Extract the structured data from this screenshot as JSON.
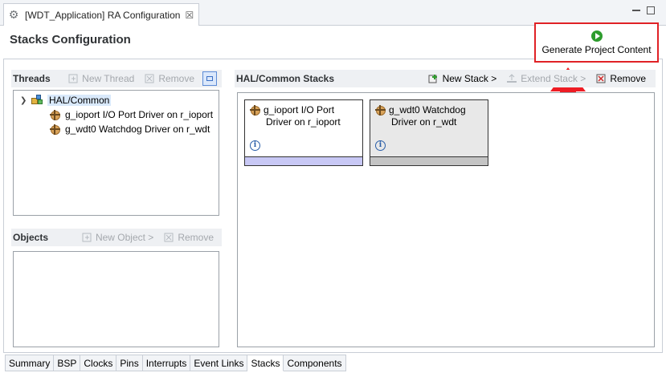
{
  "editor_tab": {
    "icon": "gear-icon",
    "title": "[WDT_Application] RA Configuration",
    "close": "☒"
  },
  "page": {
    "title": "Stacks Configuration"
  },
  "generate": {
    "label": "Generate Project Content",
    "highlight_color": "#e02226"
  },
  "threads": {
    "title": "Threads",
    "new_thread": "New Thread",
    "remove": "Remove",
    "tree": {
      "root": "HAL/Common",
      "children": [
        "g_ioport I/O Port Driver on r_ioport",
        "g_wdt0 Watchdog Driver on r_wdt"
      ]
    }
  },
  "objects": {
    "title": "Objects",
    "new_object": "New Object >",
    "remove": "Remove"
  },
  "hal": {
    "title": "HAL/Common Stacks",
    "new_stack": "New Stack >",
    "extend_stack": "Extend Stack >",
    "remove": "Remove",
    "cards": [
      {
        "line1": "g_ioport I/O Port",
        "line2": "Driver on r_ioport",
        "info": "i"
      },
      {
        "line1": "g_wdt0 Watchdog",
        "line2": "Driver on r_wdt",
        "info": "i"
      }
    ]
  },
  "bottom_tabs": [
    "Summary",
    "BSP",
    "Clocks",
    "Pins",
    "Interrupts",
    "Event Links",
    "Stacks",
    "Components"
  ],
  "active_tab": "Stacks"
}
